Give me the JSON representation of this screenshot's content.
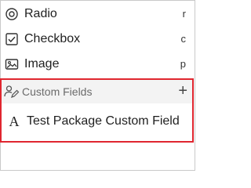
{
  "menu": {
    "items": [
      {
        "label": "Radio",
        "key": "r",
        "icon": "radio-icon"
      },
      {
        "label": "Checkbox",
        "key": "c",
        "icon": "checkbox-icon"
      },
      {
        "label": "Image",
        "key": "p",
        "icon": "image-icon"
      }
    ]
  },
  "custom_fields": {
    "header_label": "Custom Fields",
    "header_icon": "person-edit-icon",
    "add_icon": "plus-icon",
    "add_symbol": "+",
    "items": [
      {
        "label": "Test Package Custom Field",
        "glyph": "A",
        "icon": "text-field-icon"
      }
    ]
  },
  "colors": {
    "highlight_border": "#e0262f",
    "header_background": "#f3f3f3"
  }
}
